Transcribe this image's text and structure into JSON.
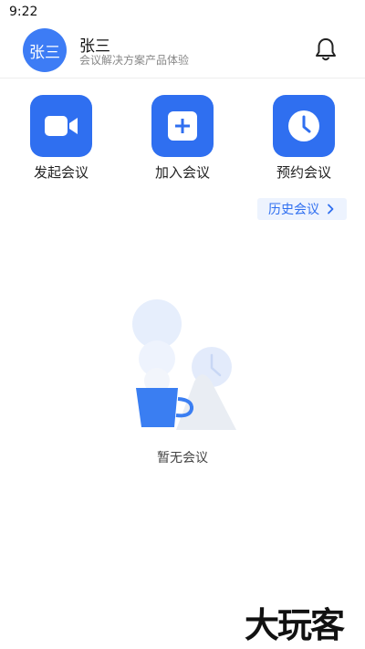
{
  "status_bar": {
    "time": "9:22"
  },
  "header": {
    "avatar_text": "张三",
    "user_name": "张三",
    "subtitle": "会议解决方案产品体验",
    "bell_icon": "bell-icon"
  },
  "actions": [
    {
      "label": "发起会议",
      "icon": "video-camera-icon"
    },
    {
      "label": "加入会议",
      "icon": "plus-icon"
    },
    {
      "label": "预约会议",
      "icon": "clock-icon"
    }
  ],
  "history_button": {
    "label": "历史会议",
    "icon": "chevron-right-icon"
  },
  "empty_state": {
    "text": "暂无会议"
  },
  "watermark": {
    "text": "大玩客"
  },
  "colors": {
    "accent": "#2f6ff0",
    "avatar": "#3d7cf5",
    "history_bg": "#edf3fe"
  }
}
